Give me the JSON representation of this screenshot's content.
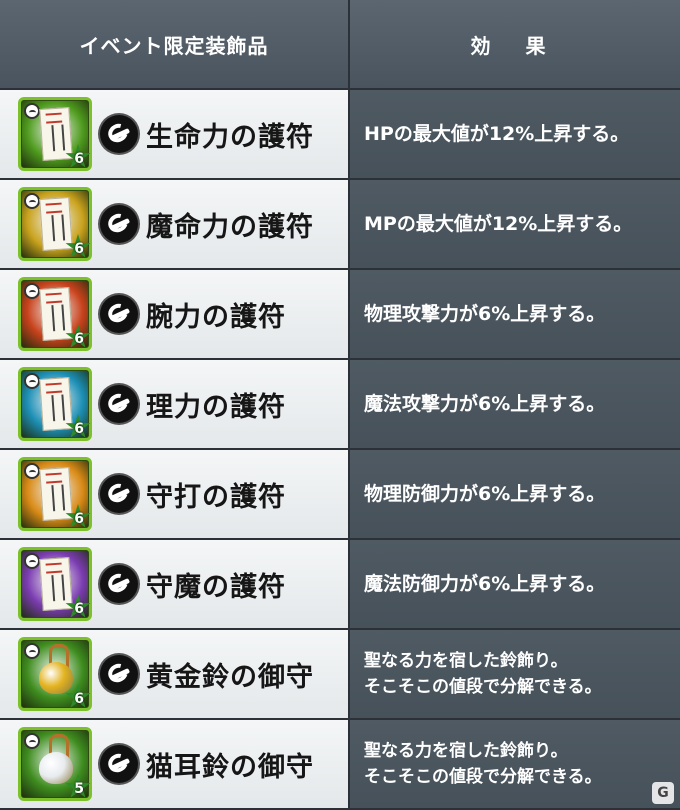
{
  "header": {
    "item_col": "イベント限定装飾品",
    "effect_col": "効 果"
  },
  "rows": [
    {
      "name": "生命力の護符",
      "effect1": "HPの最大値が12%上昇する。",
      "effect2": "",
      "stars": "6",
      "icon": "charm-green-icon",
      "frame_color": "#7cc12c",
      "bg_color": "#4f9b1e"
    },
    {
      "name": "魔命力の護符",
      "effect1": "MPの最大値が12%上昇する。",
      "effect2": "",
      "stars": "6",
      "icon": "charm-yellow-icon",
      "frame_color": "#7cc12c",
      "bg_color": "#c9a21d"
    },
    {
      "name": "腕力の護符",
      "effect1": "物理攻撃力が6%上昇する。",
      "effect2": "",
      "stars": "6",
      "icon": "charm-red-icon",
      "frame_color": "#7cc12c",
      "bg_color": "#c8421c"
    },
    {
      "name": "理力の護符",
      "effect1": "魔法攻撃力が6%上昇する。",
      "effect2": "",
      "stars": "6",
      "icon": "charm-blue-icon",
      "frame_color": "#7cc12c",
      "bg_color": "#1d8fb5"
    },
    {
      "name": "守打の護符",
      "effect1": "物理防御力が6%上昇する。",
      "effect2": "",
      "stars": "6",
      "icon": "charm-orange-icon",
      "frame_color": "#7cc12c",
      "bg_color": "#d98a16"
    },
    {
      "name": "守魔の護符",
      "effect1": "魔法防御力が6%上昇する。",
      "effect2": "",
      "stars": "6",
      "icon": "charm-purple-icon",
      "frame_color": "#7cc12c",
      "bg_color": "#7b3cb0"
    },
    {
      "name": "黄金鈴の御守",
      "effect1": "聖なる力を宿した鈴飾り。",
      "effect2": "そこそこの値段で分解できる。",
      "stars": "6",
      "icon": "golden-bell-icon",
      "frame_color": "#7cc12c",
      "bg_color": "#3f8d1f",
      "bell_color": "#e3b321"
    },
    {
      "name": "猫耳鈴の御守",
      "effect1": "聖なる力を宿した鈴飾り。",
      "effect2": "そこそこの値段で分解できる。",
      "stars": "5",
      "icon": "silver-bell-icon",
      "frame_color": "#7cc12c",
      "bg_color": "#3f8d1f",
      "bell_color": "#e8ecef"
    }
  ]
}
